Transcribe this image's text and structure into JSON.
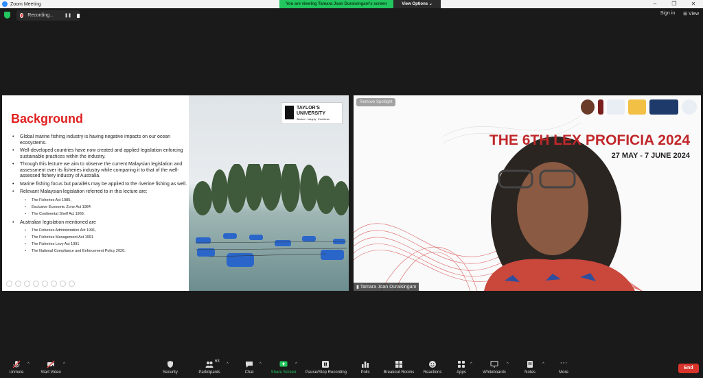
{
  "window": {
    "title": "Zoom Meeting"
  },
  "banner": {
    "viewing_text": "You are viewing Tamara Joan Duraisingam's screen",
    "view_options": "View Options"
  },
  "recording": {
    "label": "Recording..."
  },
  "topright": {
    "sign_in": "Sign in",
    "view": "View"
  },
  "slide": {
    "title": "Background",
    "bullets": [
      "Global marine fishing industry is having negative impacts on our ocean ecosystems.",
      "Well-developed countries have now created and applied legislation enforcing sustainable practices within the industry.",
      "Through this lecture we aim to observe the current Malaysian legislation and assessment over its fisheries industry while comparing it to that of the well-assessed fishery industry of Australia.",
      "Marine fishing focus but parallels may be applied to the riverine fishing as well.",
      "Relevant Malaysian legislation referred to in this lecture are:"
    ],
    "malaysian_acts": [
      "The Fisheries Act 1985,",
      "Exclusive Economic Zone Act 1984",
      "The Continental Shelf Act 1966."
    ],
    "australian_heading": "Australian legislation mentioned are",
    "australian_acts": [
      "The Fisheries Administration Act 1991,",
      "The Fisheries Management Act 1991",
      "The Fisheries Levy Act 1991",
      "The National Compliance and Enforcement Policy 2020."
    ],
    "logo_name": "TAYLOR'S",
    "logo_sub": "UNIVERSITY",
    "logo_tag": "Wisdom · Integrity · Excellence"
  },
  "video": {
    "remove_spotlight": "Remove Spotlight",
    "event_title": "THE 6TH LEX PROFICIA 2024",
    "event_dates": "27 MAY - 7 JUNE 2024",
    "participant_name": "Tamara Joan Duraisingam"
  },
  "toolbar": {
    "unmute": "Unmute",
    "start_video": "Start Video",
    "security": "Security",
    "participants": "Participants",
    "participants_count": "63",
    "chat": "Chat",
    "share_screen": "Share Screen",
    "record": "Pause/Stop Recording",
    "polls": "Polls",
    "breakout": "Breakout Rooms",
    "reactions": "Reactions",
    "apps": "Apps",
    "whiteboards": "Whiteboards",
    "notes": "Notes",
    "more": "More",
    "end": "End"
  },
  "colors": {
    "accent_green": "#22c55e",
    "end_red": "#d9342b",
    "title_red": "#e02020"
  }
}
